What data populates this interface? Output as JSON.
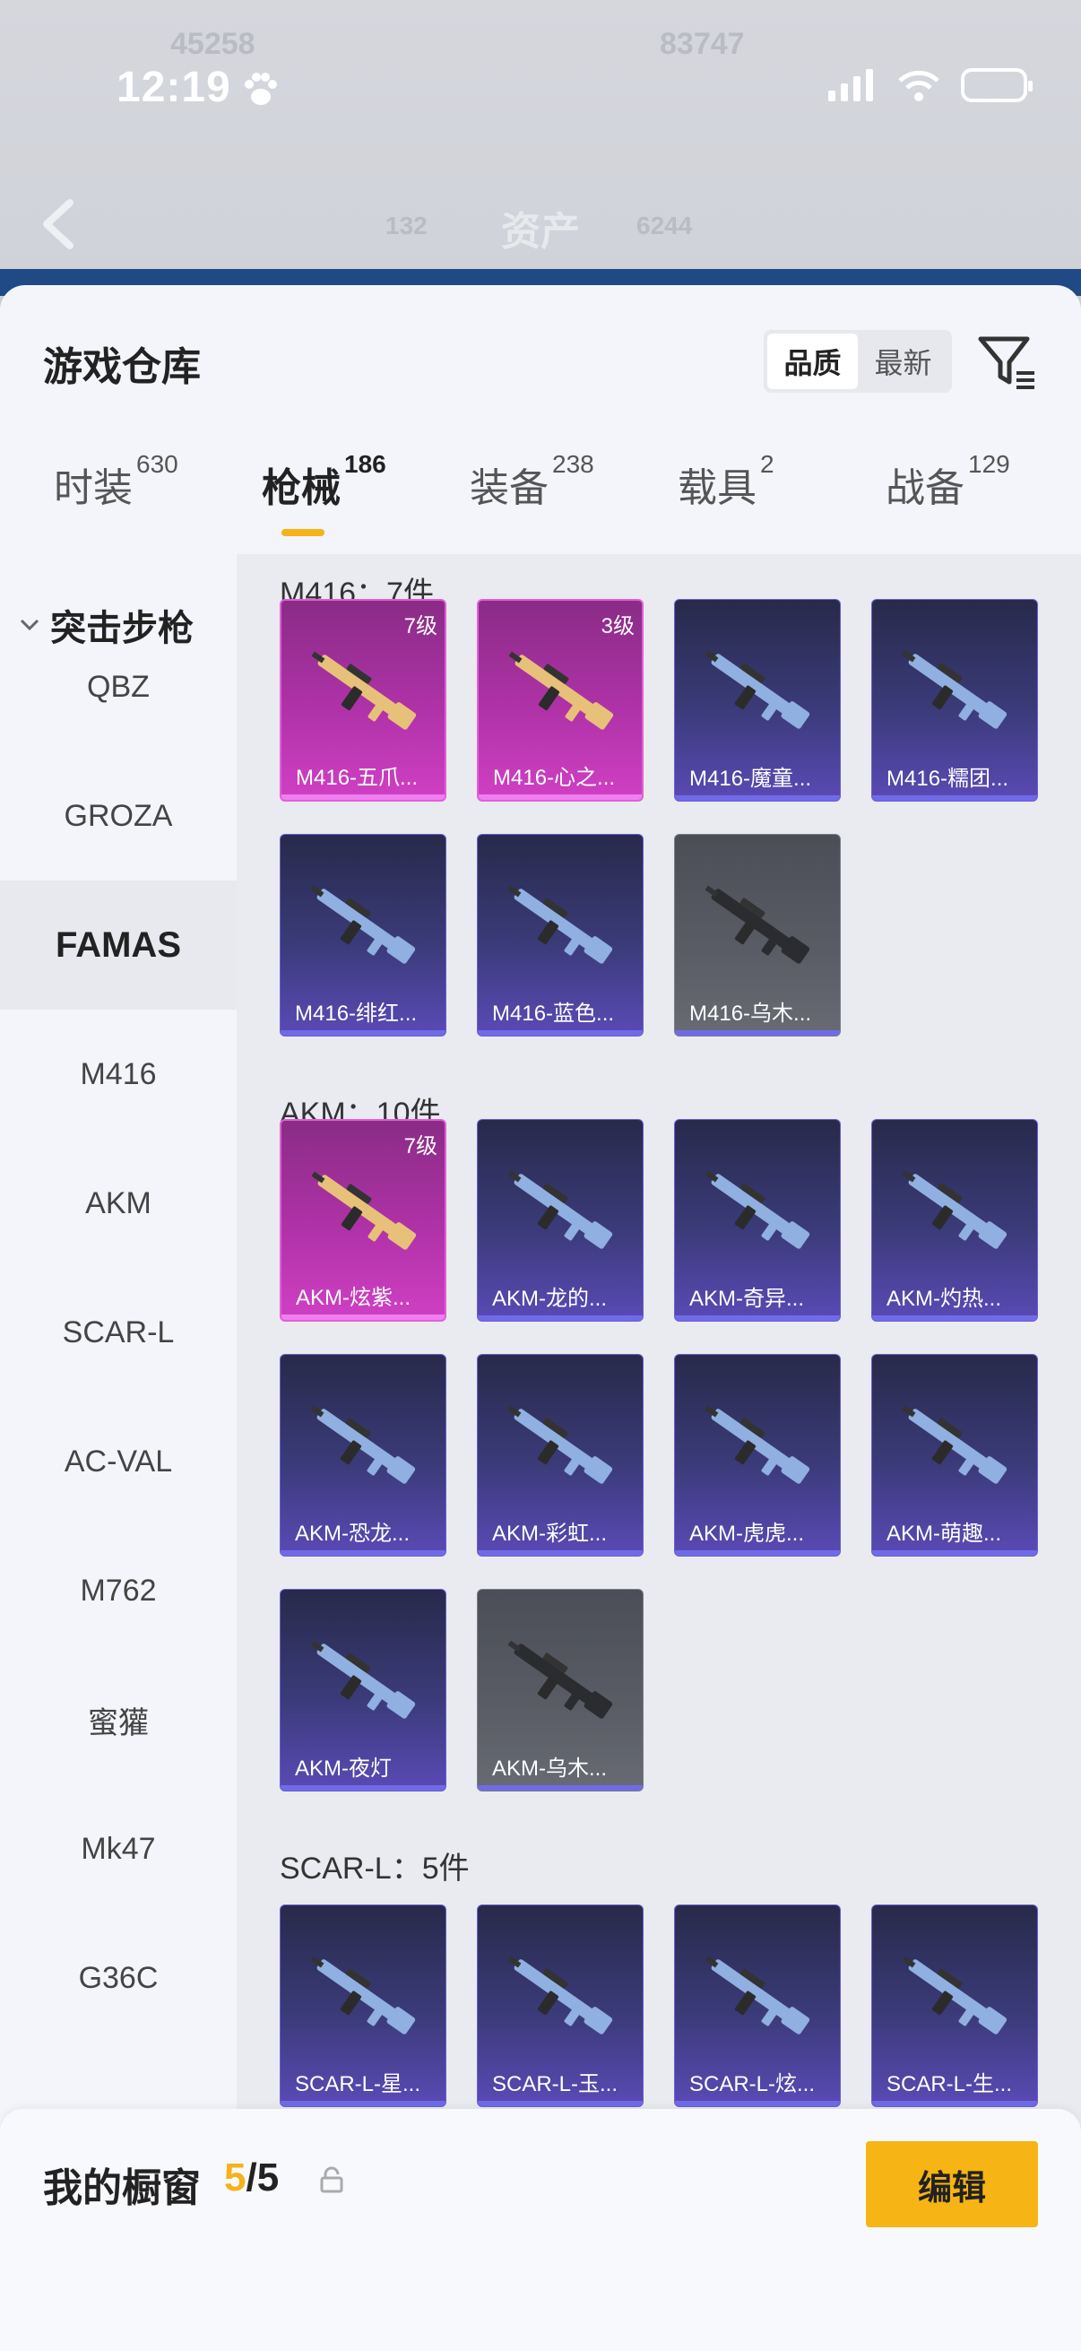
{
  "status_bar": {
    "time": "12:19"
  },
  "background_header": {
    "title": "资产",
    "ghost_stats": [
      "45258",
      "83747",
      "132",
      "6244"
    ]
  },
  "sheet": {
    "title": "游戏仓库",
    "sort_options": [
      {
        "label": "品质",
        "active": true
      },
      {
        "label": "最新",
        "active": false
      }
    ]
  },
  "tabs": [
    {
      "label": "时装",
      "count": "630"
    },
    {
      "label": "枪械",
      "count": "186",
      "active": true
    },
    {
      "label": "装备",
      "count": "238"
    },
    {
      "label": "载具",
      "count": "2"
    },
    {
      "label": "战备",
      "count": "129"
    }
  ],
  "sidebar": {
    "category": "突击步枪",
    "items": [
      "QBZ",
      "GROZA",
      "FAMAS",
      "M416",
      "AKM",
      "SCAR-L",
      "AC-VAL",
      "M762",
      "蜜獾",
      "Mk47",
      "G36C"
    ],
    "active": "FAMAS"
  },
  "groups": [
    {
      "label": "M416：7件",
      "items": [
        {
          "name": "M416-五爪...",
          "level": "7级",
          "rarity": "purple"
        },
        {
          "name": "M416-心之...",
          "level": "3级",
          "rarity": "purple"
        },
        {
          "name": "M416-魔童...",
          "level": "",
          "rarity": "blue"
        },
        {
          "name": "M416-糯团...",
          "level": "",
          "rarity": "blue"
        },
        {
          "name": "M416-绯红...",
          "level": "",
          "rarity": "blue"
        },
        {
          "name": "M416-蓝色...",
          "level": "",
          "rarity": "blue"
        },
        {
          "name": "M416-乌木...",
          "level": "",
          "rarity": "grey"
        }
      ]
    },
    {
      "label": "AKM：10件",
      "items": [
        {
          "name": "AKM-炫紫...",
          "level": "7级",
          "rarity": "purple"
        },
        {
          "name": "AKM-龙的...",
          "level": "",
          "rarity": "blue"
        },
        {
          "name": "AKM-奇异...",
          "level": "",
          "rarity": "blue"
        },
        {
          "name": "AKM-灼热...",
          "level": "",
          "rarity": "blue"
        },
        {
          "name": "AKM-恐龙...",
          "level": "",
          "rarity": "blue"
        },
        {
          "name": "AKM-彩虹...",
          "level": "",
          "rarity": "blue"
        },
        {
          "name": "AKM-虎虎...",
          "level": "",
          "rarity": "blue"
        },
        {
          "name": "AKM-萌趣...",
          "level": "",
          "rarity": "blue"
        },
        {
          "name": "AKM-夜灯",
          "level": "",
          "rarity": "blue"
        },
        {
          "name": "AKM-乌木...",
          "level": "",
          "rarity": "grey"
        }
      ]
    },
    {
      "label": "SCAR-L：5件",
      "items": [
        {
          "name": "SCAR-L-星...",
          "level": "",
          "rarity": "blue"
        },
        {
          "name": "SCAR-L-玉...",
          "level": "",
          "rarity": "blue"
        },
        {
          "name": "SCAR-L-炫...",
          "level": "",
          "rarity": "blue"
        },
        {
          "name": "SCAR-L-生...",
          "level": "",
          "rarity": "blue"
        }
      ]
    }
  ],
  "bottom_bar": {
    "label": "我的橱窗",
    "current": "5",
    "total": "/5",
    "edit_label": "编辑"
  },
  "colors": {
    "accent": "#f5b21a",
    "purple_rarity": "#b032a8",
    "blue_rarity": "#3b3b7a",
    "grey_rarity": "#5a5d65"
  }
}
